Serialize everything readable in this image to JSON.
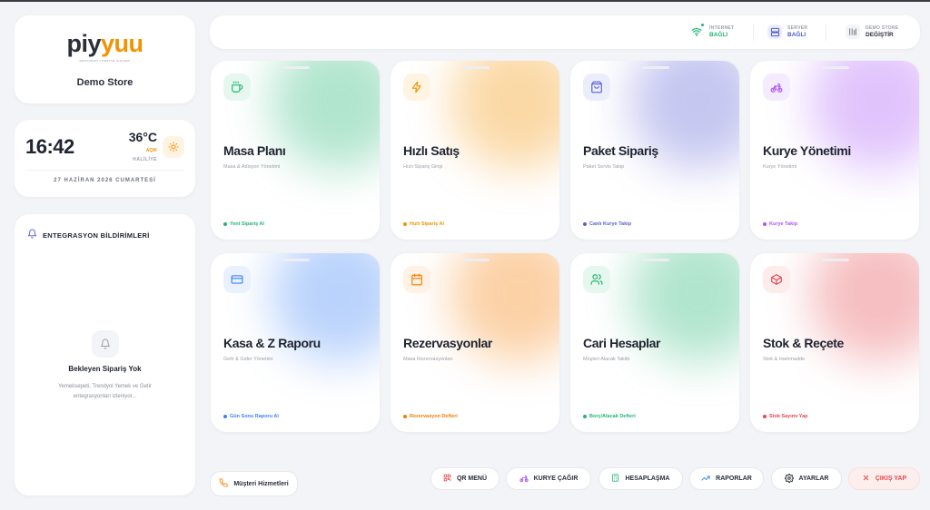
{
  "brand": {
    "logo_part1": "piy",
    "logo_part2": "yuu",
    "tagline": "RESTORAN YÖNETİM SİSTEMİ",
    "store_name": "Demo Store"
  },
  "clock": {
    "time": "16:42",
    "temperature": "36°C",
    "condition": "AÇIK",
    "city": "HALİLİYE",
    "date": "27 HAZİRAN 2026 CUMARTESİ"
  },
  "notifications": {
    "title": "ENTEGRASYON BİLDİRİMLERİ",
    "empty_title": "Bekleyen Sipariş Yok",
    "empty_subtitle": "Yemeksepeti, Trendyol Yemek ve Getir entegrasyonları izleniyor..."
  },
  "status": {
    "internet": {
      "label": "İNTERNET",
      "value": "BAĞLI",
      "color": "#22b573"
    },
    "server": {
      "label": "SERVER",
      "value": "BAĞLI",
      "color": "#4c5bd4"
    },
    "store": {
      "label": "DEMO STORE",
      "value": "DEĞİŞTİR",
      "color": "#2b2f3a"
    }
  },
  "cards": [
    {
      "title": "Masa Planı",
      "subtitle": "Masa & Adisyon Yönetimi",
      "footer": "Yeni Sipariş Al",
      "icon": "coffee-icon",
      "color": "#22b573",
      "bg": "#e6f7ef"
    },
    {
      "title": "Hızlı Satış",
      "subtitle": "Hızlı Sipariş Girişi",
      "footer": "Hızlı Sipariş Al",
      "icon": "bolt-icon",
      "color": "#f39200",
      "bg": "#fff3e2"
    },
    {
      "title": "Paket Sipariş",
      "subtitle": "Paket Servis Takip",
      "footer": "Canlı Kurye Takip",
      "icon": "bag-icon",
      "color": "#5b5fd6",
      "bg": "#ecedfb"
    },
    {
      "title": "Kurye Yönetimi",
      "subtitle": "Kurye Yönetimi",
      "footer": "Kurye Takip",
      "icon": "bicycle-icon",
      "color": "#a855f7",
      "bg": "#f4ecfe"
    },
    {
      "title": "Kasa & Z Raporu",
      "subtitle": "Gelir & Gider Yönetimi",
      "footer": "Gün Sonu Raporu Al",
      "icon": "card-icon",
      "color": "#3b82f6",
      "bg": "#e9f1fe"
    },
    {
      "title": "Rezervasyonlar",
      "subtitle": "Masa Rezervasyonları",
      "footer": "Rezervasyon Defteri",
      "icon": "calendar-icon",
      "color": "#f57c00",
      "bg": "#fff1e3"
    },
    {
      "title": "Cari Hesaplar",
      "subtitle": "Müşteri Alacak Takibi",
      "footer": "Borç/Alacak Defteri",
      "icon": "users-icon",
      "color": "#22b573",
      "bg": "#e6f7ef"
    },
    {
      "title": "Stok & Reçete",
      "subtitle": "Stok & Hammadde",
      "footer": "Stok Sayımı Yap",
      "icon": "cube-icon",
      "color": "#e5484d",
      "bg": "#fdecec"
    }
  ],
  "bottom": {
    "support": "Müşteri Hizmetleri",
    "qr": "QR MENÜ",
    "courier": "KURYE ÇAĞIR",
    "settle": "HESAPLAŞMA",
    "reports": "RAPORLAR",
    "settings": "AYARLAR",
    "exit": "ÇIKIŞ YAP"
  }
}
